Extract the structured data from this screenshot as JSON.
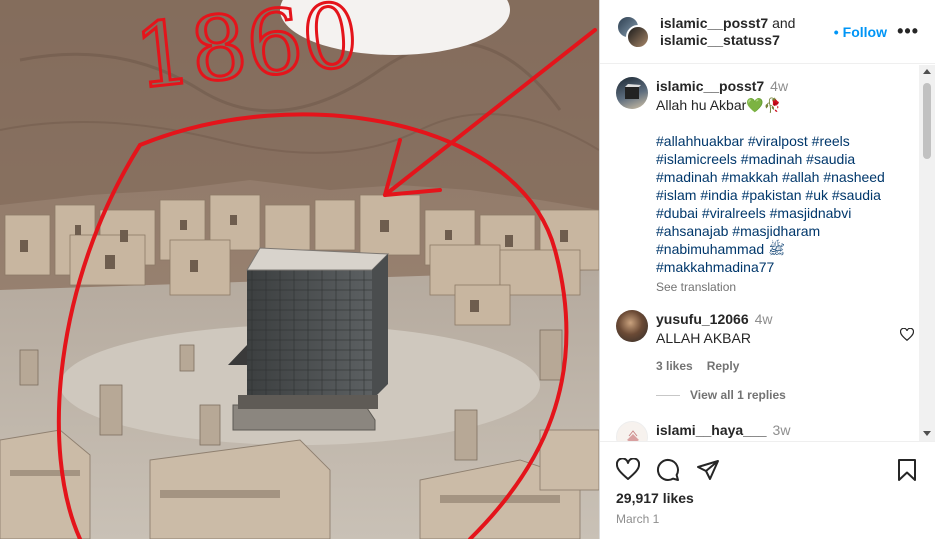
{
  "post": {
    "header": {
      "user1": "islamic__posst7",
      "conjunction": "and",
      "user2": "islamic__statuss7",
      "follow_label": "Follow",
      "follow_dot": "•",
      "more_label": "•••"
    },
    "media": {
      "overlay_text": "1860"
    },
    "caption": {
      "username": "islamic__posst7",
      "time": "4w",
      "text": "Allah hu Akbar💚🥀",
      "hashtags": "#allahhuakbar #viralpost #reels\n#islamicreels #madinah #saudia\n#madinah #makkah #allah #nasheed\n#islam #india #pakistan #uk #saudia\n#dubai #viralreels #masjidnabvi\n#ahsanajab #masjidharam\n#nabimuhammad ﷺ\n#makkahmadina77",
      "see_translation": "See translation"
    },
    "comments": [
      {
        "username": "yusufu_12066",
        "time": "4w",
        "text": "ALLAH AKBAR",
        "likes_label": "3 likes",
        "reply_label": "Reply",
        "view_replies": "View all 1 replies"
      },
      {
        "username": "islami__haya___",
        "time": "3w"
      }
    ],
    "actions": {
      "likes": "29,917 likes",
      "date": "March 1"
    }
  },
  "colors": {
    "link_blue": "#0095f6",
    "hashtag": "#00376b",
    "annotation_red": "#e4141b",
    "muted": "#737373"
  },
  "icons": {
    "like": "heart-icon",
    "comment": "comment-bubble-icon",
    "share": "paper-plane-icon",
    "save": "bookmark-icon",
    "comment_like": "heart-icon",
    "more": "ellipsis-icon"
  }
}
